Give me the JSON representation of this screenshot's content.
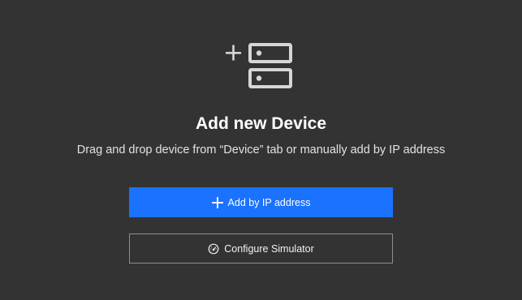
{
  "panel": {
    "title": "Add new Device",
    "subtitle": "Drag and drop device from “Device” tab or manually add by IP address",
    "hero_icon": "add-device-icon"
  },
  "actions": {
    "add_by_ip_label": "Add by IP address",
    "add_by_ip_icon": "plus-icon",
    "configure_simulator_label": "Configure Simulator",
    "configure_simulator_icon": "gauge-icon"
  },
  "colors": {
    "background": "#333333",
    "primary_button": "#1a72ff",
    "secondary_border": "#8e8e8e",
    "icon_gray": "#d6d6d6"
  }
}
